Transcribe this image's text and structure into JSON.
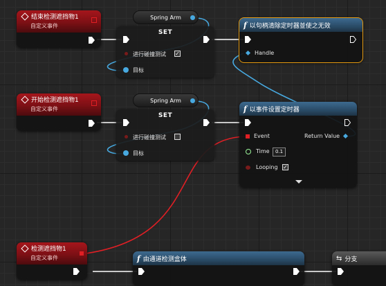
{
  "colors": {
    "exec": "#ffffff",
    "object": "#47a9e0",
    "delegate": "#e01f25",
    "boolean": "#7a1b1b",
    "float": "#9cf59a",
    "selection": "#e59a10"
  },
  "event1": {
    "title": "结束检测遮挡物1",
    "subtitle": "自定义事件"
  },
  "event2": {
    "title": "开始检测遮挡物1",
    "subtitle": "自定义事件"
  },
  "event3": {
    "title": "检测遮挡物1",
    "subtitle": "自定义事件"
  },
  "pill1": {
    "label": "Spring Arm"
  },
  "pill2": {
    "label": "Spring Arm"
  },
  "set1": {
    "title": "SET",
    "bool_label": "进行碰撞测试",
    "bool_checked": "✓",
    "target_label": "目标"
  },
  "set2": {
    "title": "SET",
    "bool_label": "进行碰撞测试",
    "bool_checked": "",
    "target_label": "目标"
  },
  "clear_timer": {
    "title": "以句柄清除定时器並使之无效",
    "handle_label": "Handle"
  },
  "set_timer": {
    "title": "以事件设置定时器",
    "event_label": "Event",
    "return_label": "Return Value",
    "time_label": "Time",
    "time_value": "0.1",
    "looping_label": "Looping",
    "looping_checked": "✓"
  },
  "box_trace": {
    "title": "由通道检测盒体"
  },
  "branch": {
    "title": "分支"
  }
}
